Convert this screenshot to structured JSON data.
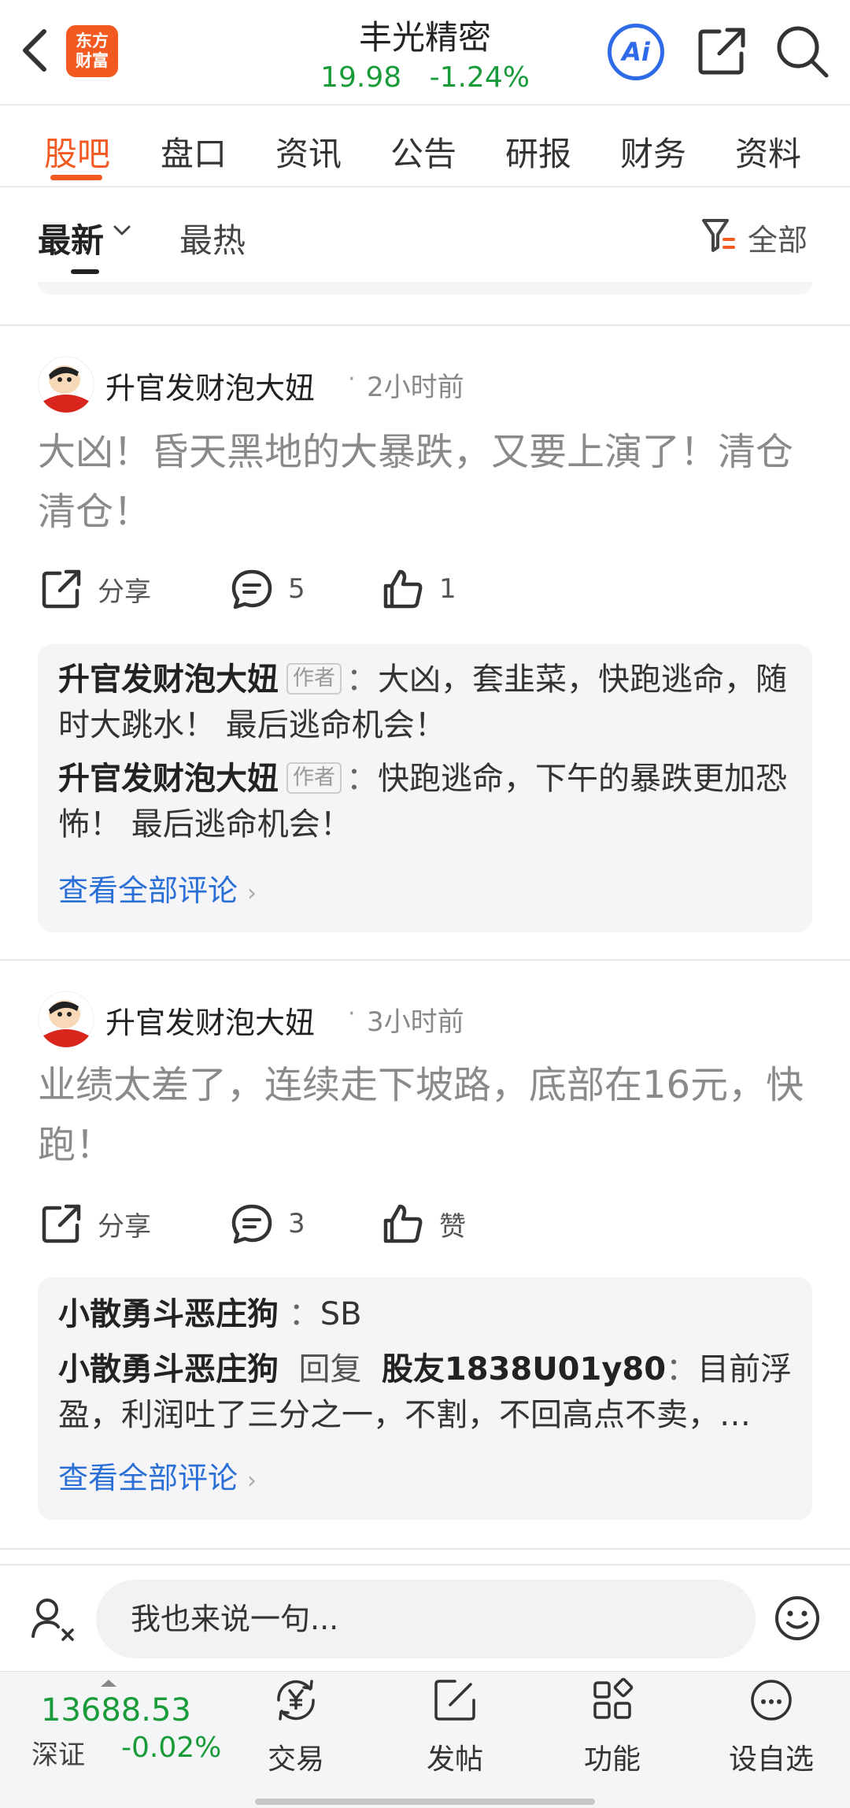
{
  "header": {
    "logo_line1": "东方",
    "logo_line2": "财富",
    "stock_name": "丰光精密",
    "price": "19.98",
    "change": "-1.24%",
    "ai_label": "Ai"
  },
  "tabs": [
    {
      "label": "股吧",
      "active": true
    },
    {
      "label": "盘口"
    },
    {
      "label": "资讯"
    },
    {
      "label": "公告"
    },
    {
      "label": "研报"
    },
    {
      "label": "财务"
    },
    {
      "label": "资料"
    }
  ],
  "filter": {
    "latest": "最新",
    "hot": "最热",
    "all": "全部"
  },
  "posts": [
    {
      "author": "升官发财泡大妞",
      "time": "2小时前",
      "body": "大凶！昏天黑地的大暴跌，又要上演了！清仓清仓！",
      "share_label": "分享",
      "comment_count": "5",
      "like_count": "1",
      "comments": [
        {
          "name": "升官发财泡大妞",
          "tag": "作者",
          "text": "大凶，套韭菜，快跑逃命，随时大跳水！ 最后逃命机会！"
        },
        {
          "name": "升官发财泡大妞",
          "tag": "作者",
          "text": "快跑逃命，下午的暴跌更加恐怖！ 最后逃命机会！"
        }
      ],
      "view_all": "查看全部评论"
    },
    {
      "author": "升官发财泡大妞",
      "time": "3小时前",
      "body": "业绩太差了，连续走下坡路，底部在16元，快跑！",
      "share_label": "分享",
      "comment_count": "3",
      "like_count": "赞",
      "comments": [
        {
          "name": "小散勇斗恶庄狗",
          "text": "SB"
        },
        {
          "name": "小散勇斗恶庄狗",
          "reply_word": "回复",
          "reply_to": "股友1838U01y80",
          "text": "目前浮盈，利润吐了三分之一，不割，不回高点不卖，…"
        }
      ],
      "view_all": "查看全部评论"
    }
  ],
  "comment_input": {
    "placeholder": "我也来说一句..."
  },
  "index": {
    "value": "13688.53",
    "name": "深证",
    "change": "-0.02%"
  },
  "bottom_nav": [
    {
      "label": "交易",
      "icon": "yen-exchange-icon"
    },
    {
      "label": "发帖",
      "icon": "edit-post-icon"
    },
    {
      "label": "功能",
      "icon": "grid-apps-icon"
    },
    {
      "label": "设自选",
      "icon": "add-watchlist-icon"
    }
  ],
  "colors": {
    "accent": "#f25a22",
    "down_green": "#1a9b3a",
    "link_blue": "#2a6fd6",
    "ai_blue": "#2f6ae8"
  }
}
